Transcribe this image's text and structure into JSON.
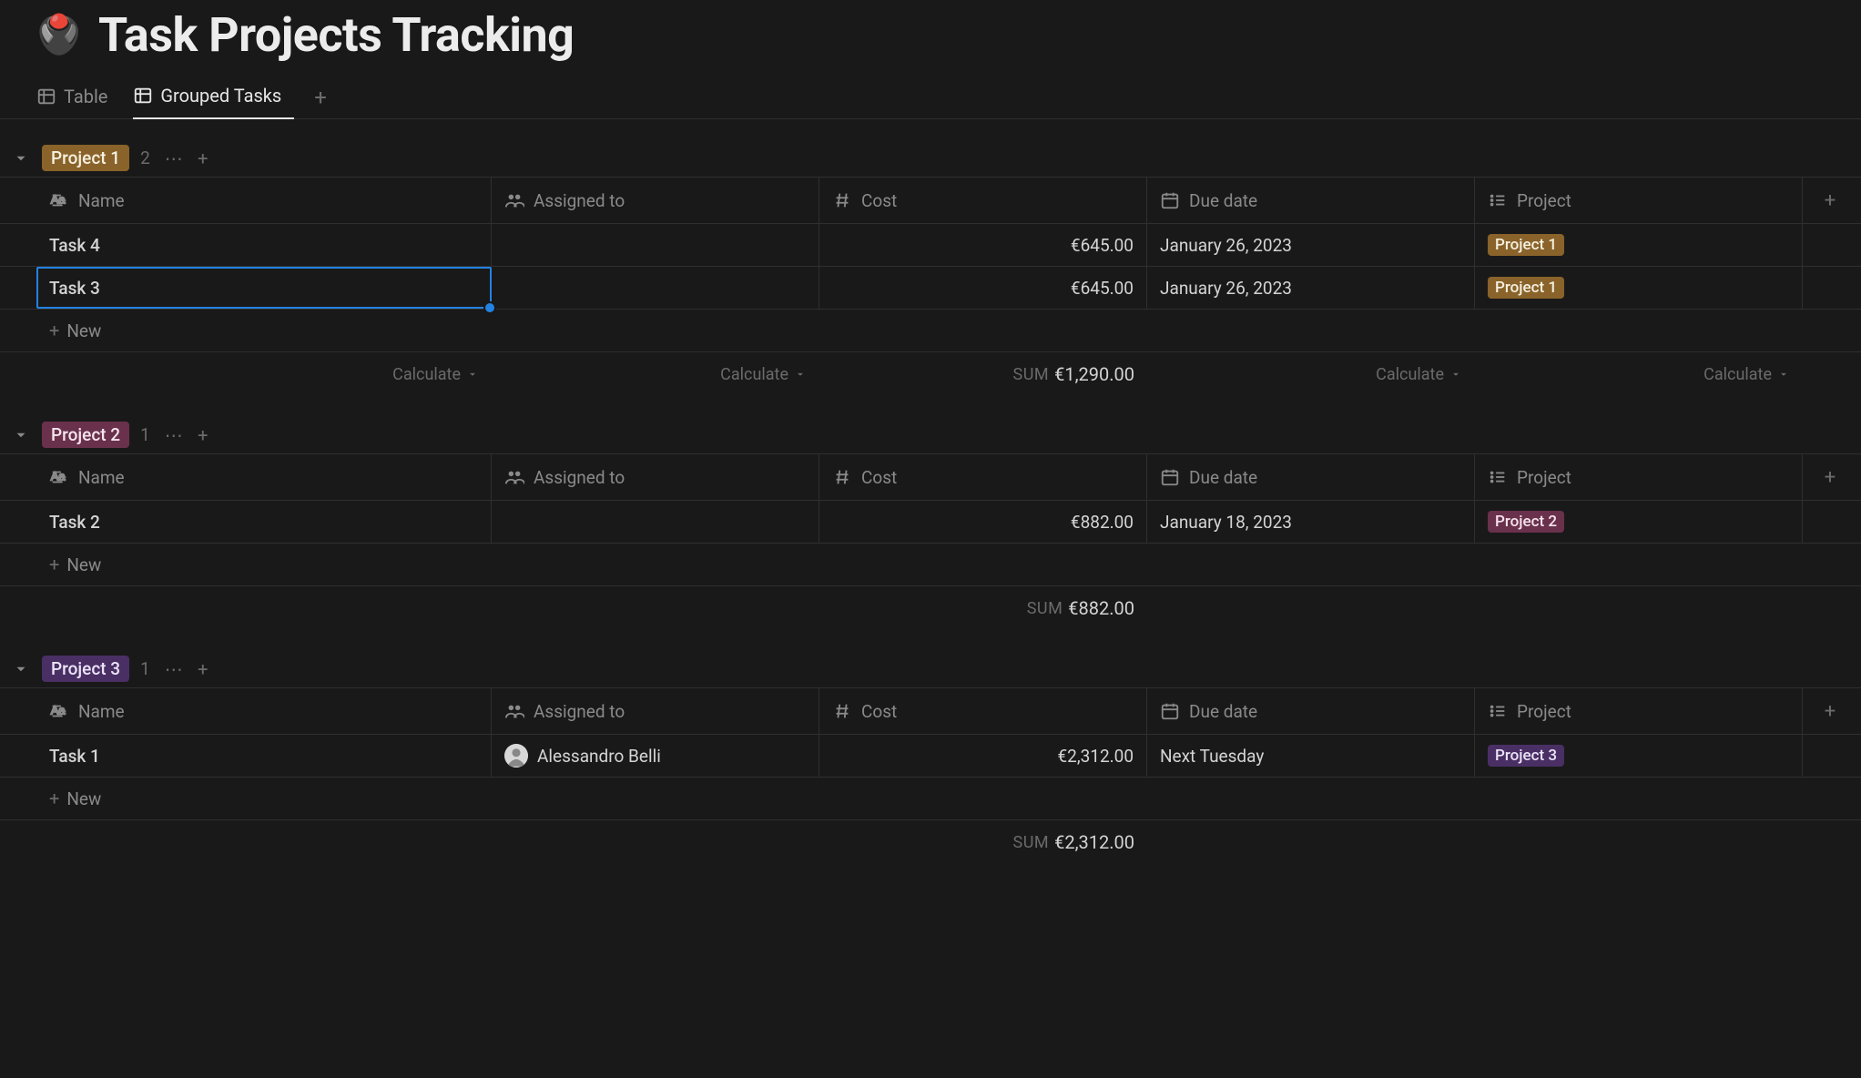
{
  "page": {
    "icon": "🖲️",
    "title": "Task Projects Tracking"
  },
  "tabs": [
    {
      "label": "Table",
      "active": false
    },
    {
      "label": "Grouped Tasks",
      "active": true
    }
  ],
  "columns": {
    "name": "Name",
    "assigned": "Assigned to",
    "cost": "Cost",
    "due": "Due date",
    "project": "Project"
  },
  "newRowLabel": "New",
  "calculateLabel": "Calculate",
  "sumLabel": "SUM",
  "groups": [
    {
      "tag": "Project 1",
      "color": "yellow",
      "count": "2",
      "rows": [
        {
          "name": "Task 4",
          "assigned": "",
          "cost": "€645.00",
          "due": "January 26, 2023",
          "project": "Project 1",
          "projectColor": "yellow",
          "selected": false
        },
        {
          "name": "Task 3",
          "assigned": "",
          "cost": "€645.00",
          "due": "January 26, 2023",
          "project": "Project 1",
          "projectColor": "yellow",
          "selected": true
        }
      ],
      "sum": "€1,290.00",
      "showCalcInactive": true
    },
    {
      "tag": "Project 2",
      "color": "pink",
      "count": "1",
      "rows": [
        {
          "name": "Task 2",
          "assigned": "",
          "cost": "€882.00",
          "due": "January 18, 2023",
          "project": "Project 2",
          "projectColor": "pink",
          "selected": false
        }
      ],
      "sum": "€882.00",
      "showCalcInactive": false
    },
    {
      "tag": "Project 3",
      "color": "purple",
      "count": "1",
      "rows": [
        {
          "name": "Task 1",
          "assigned": "Alessandro Belli",
          "cost": "€2,312.00",
          "due": "Next Tuesday",
          "project": "Project 3",
          "projectColor": "purple",
          "selected": false
        }
      ],
      "sum": "€2,312.00",
      "showCalcInactive": false
    }
  ]
}
